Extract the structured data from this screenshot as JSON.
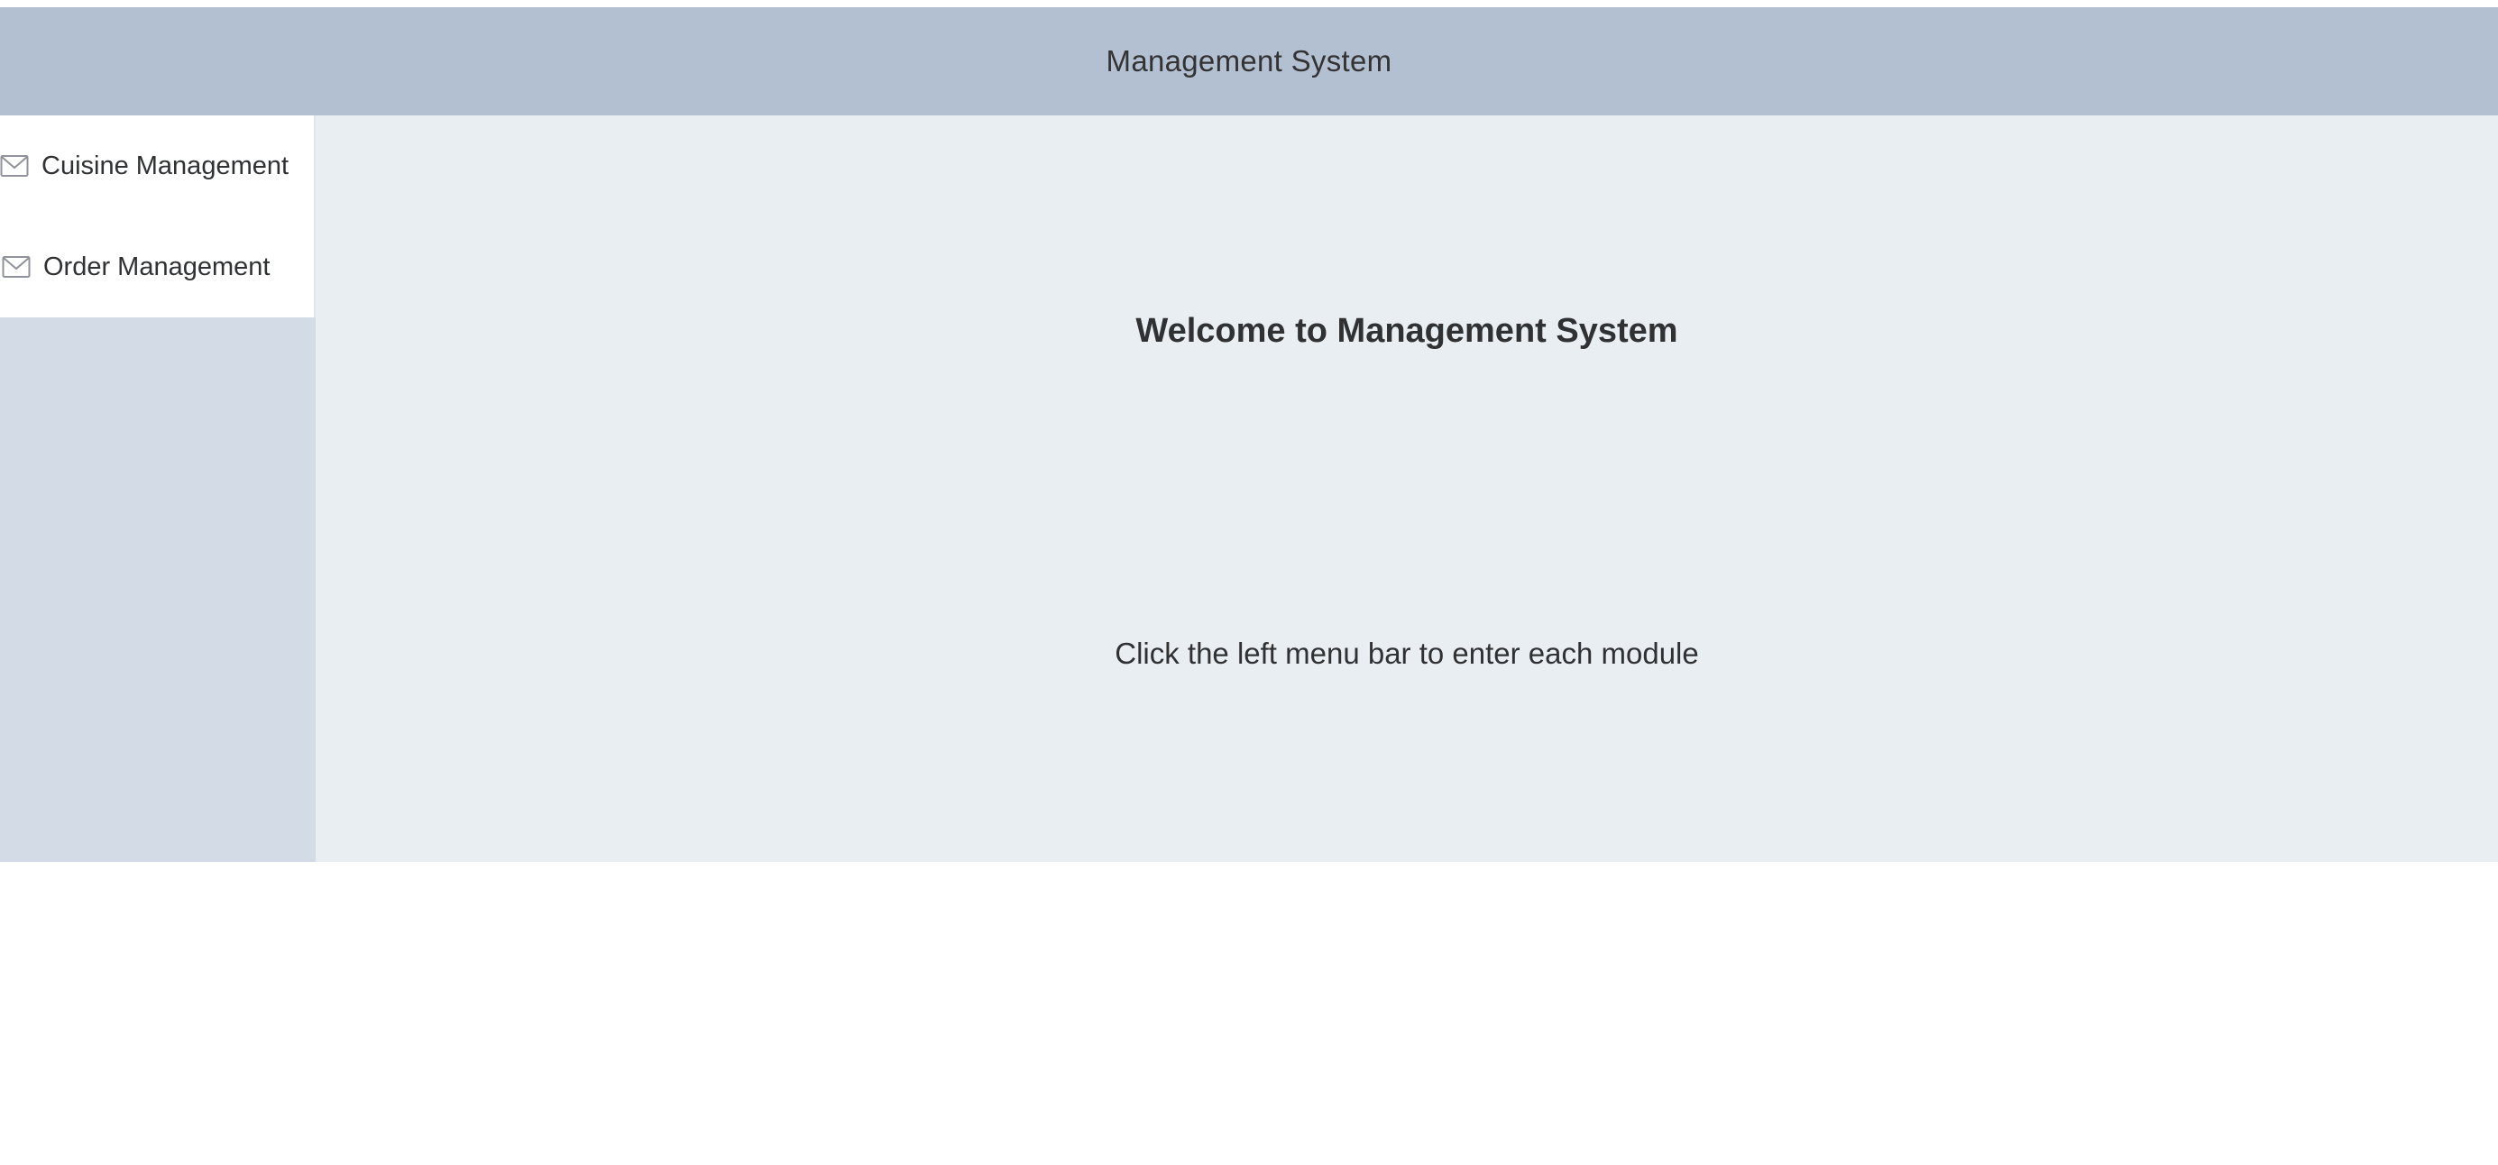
{
  "header": {
    "title": "Management System"
  },
  "sidebar": {
    "items": [
      {
        "label": "Cuisine Management",
        "icon": "message-icon"
      },
      {
        "label": "Order Management",
        "icon": "message-icon"
      }
    ]
  },
  "main": {
    "welcome": "Welcome to Management System",
    "hint": "Click the left menu bar to enter each module"
  },
  "colors": {
    "header_bg": "#b3c0d1",
    "aside_bg": "#d3dce6",
    "main_bg": "#e9eef3",
    "menu_bg": "#ffffff",
    "text": "#303133"
  }
}
